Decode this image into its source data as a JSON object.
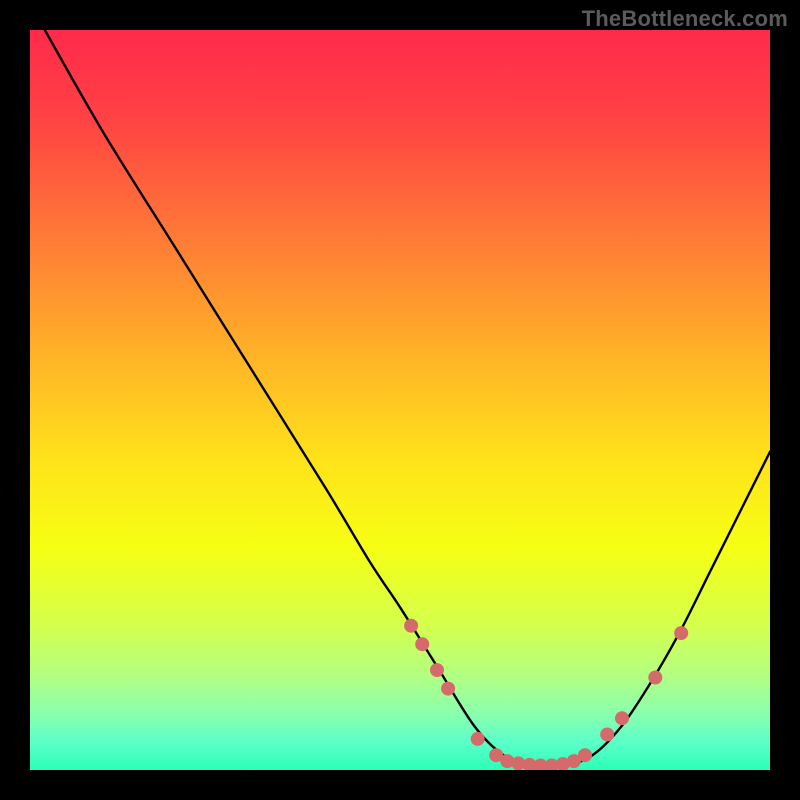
{
  "watermark": "TheBottleneck.com",
  "chart_data": {
    "type": "line",
    "title": "",
    "xlabel": "",
    "ylabel": "",
    "xlim": [
      0,
      100
    ],
    "ylim": [
      0,
      100
    ],
    "series": [
      {
        "name": "curve",
        "x": [
          2,
          10,
          20,
          30,
          40,
          46,
          50,
          55,
          60,
          64,
          68,
          72,
          76,
          80,
          84,
          88,
          92,
          96,
          100
        ],
        "y": [
          100,
          86,
          70,
          54,
          38,
          28,
          22,
          14,
          6,
          2,
          0.5,
          0.5,
          2,
          6,
          12,
          19,
          27,
          35,
          43
        ]
      }
    ],
    "markers": [
      {
        "x": 51.5,
        "y": 19.5
      },
      {
        "x": 53.0,
        "y": 17.0
      },
      {
        "x": 55.0,
        "y": 13.5
      },
      {
        "x": 56.5,
        "y": 11.0
      },
      {
        "x": 60.5,
        "y": 4.2
      },
      {
        "x": 63.0,
        "y": 2.0
      },
      {
        "x": 64.5,
        "y": 1.2
      },
      {
        "x": 66.0,
        "y": 0.9
      },
      {
        "x": 67.5,
        "y": 0.7
      },
      {
        "x": 69.0,
        "y": 0.6
      },
      {
        "x": 70.5,
        "y": 0.6
      },
      {
        "x": 72.0,
        "y": 0.8
      },
      {
        "x": 73.5,
        "y": 1.2
      },
      {
        "x": 75.0,
        "y": 2.0
      },
      {
        "x": 78.0,
        "y": 4.8
      },
      {
        "x": 80.0,
        "y": 7.0
      },
      {
        "x": 84.5,
        "y": 12.5
      },
      {
        "x": 88.0,
        "y": 18.5
      }
    ],
    "gradient_stops": [
      {
        "pos": 0.0,
        "color": "#ff2a4b"
      },
      {
        "pos": 0.12,
        "color": "#ff4244"
      },
      {
        "pos": 0.28,
        "color": "#ff7a36"
      },
      {
        "pos": 0.44,
        "color": "#ffb327"
      },
      {
        "pos": 0.58,
        "color": "#ffe21a"
      },
      {
        "pos": 0.7,
        "color": "#f6ff14"
      },
      {
        "pos": 0.8,
        "color": "#d6ff4a"
      },
      {
        "pos": 0.87,
        "color": "#b4ff80"
      },
      {
        "pos": 0.92,
        "color": "#8dffaa"
      },
      {
        "pos": 0.96,
        "color": "#5effc8"
      },
      {
        "pos": 1.0,
        "color": "#2bffb8"
      }
    ],
    "marker_color": "#d46a6a",
    "curve_color": "#000000"
  }
}
